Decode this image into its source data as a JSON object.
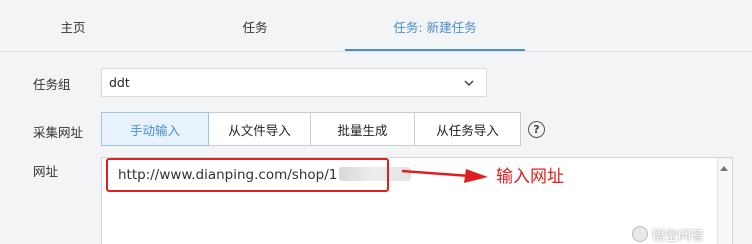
{
  "tabs": [
    {
      "label": "主页"
    },
    {
      "label": "任务"
    },
    {
      "label": "任务: 新建任务"
    }
  ],
  "form": {
    "group_label": "任务组",
    "group_value": "ddt",
    "mode_label": "采集网址",
    "modes": [
      "手动输入",
      "从文件导入",
      "批量生成",
      "从任务导入"
    ],
    "help_symbol": "?",
    "url_label": "网址",
    "url_value": "http://www.dianping.com/shop/1"
  },
  "annotation": {
    "text": "输入网址",
    "color": "#e02020"
  },
  "watermark": {
    "text": "悟空问答"
  },
  "colors": {
    "accent": "#4a8fcf"
  }
}
